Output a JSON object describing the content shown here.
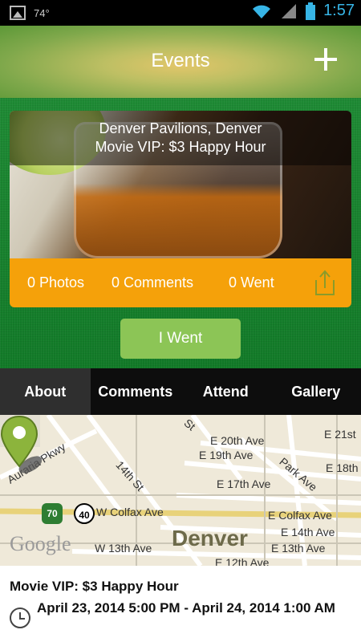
{
  "status_bar": {
    "temperature": "74°",
    "time": "1:57"
  },
  "header": {
    "title": "Events"
  },
  "event": {
    "caption_line1": "Denver Pavilions, Denver",
    "caption_line2": "Movie VIP: $3 Happy Hour",
    "photos": "0 Photos",
    "comments": "0 Comments",
    "went": "0 Went",
    "went_button": "I Went"
  },
  "tabs": [
    {
      "label": "About",
      "active": true
    },
    {
      "label": "Comments",
      "active": false
    },
    {
      "label": "Attend",
      "active": false
    },
    {
      "label": "Gallery",
      "active": false
    }
  ],
  "map": {
    "streets": [
      "Auraria Pkwy",
      "14th St",
      "W Colfax Ave",
      "E Colfax Ave",
      "E 20th Ave",
      "E 19th Ave",
      "E 17th Ave",
      "E 14th Ave",
      "E 13th Ave",
      "W 13th Ave",
      "E 12th Ave",
      "E 21st",
      "E 18th",
      "Park Ave",
      "St"
    ],
    "city": "Denver",
    "logo": "Google",
    "shields": [
      "70",
      "40"
    ]
  },
  "details": {
    "title": "Movie VIP: $3 Happy Hour",
    "date_range": "April 23, 2014 5:00 PM - April 24, 2014 1:00 AM"
  },
  "colors": {
    "accent_orange": "#f5a10a",
    "button_green": "#8cc556",
    "background_green": "#1b8431",
    "time_blue": "#37b5e6"
  }
}
